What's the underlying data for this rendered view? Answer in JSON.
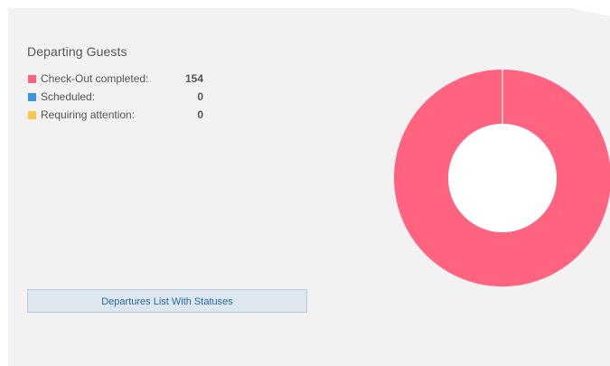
{
  "panel": {
    "title": "Departing Guests"
  },
  "legend": [
    {
      "label": "Check-Out completed:",
      "value": "154",
      "color": "#ff6380"
    },
    {
      "label": "Scheduled:",
      "value": "0",
      "color": "#3696d9"
    },
    {
      "label": "Requiring attention:",
      "value": "0",
      "color": "#ffc54d"
    }
  ],
  "button": {
    "label": "Departures List With Statuses"
  },
  "chart_data": {
    "type": "pie",
    "donut": true,
    "categories": [
      "Check-Out completed",
      "Scheduled",
      "Requiring attention"
    ],
    "values": [
      154,
      0,
      0
    ],
    "colors": [
      "#ff6380",
      "#3696d9",
      "#ffc54d"
    ]
  }
}
